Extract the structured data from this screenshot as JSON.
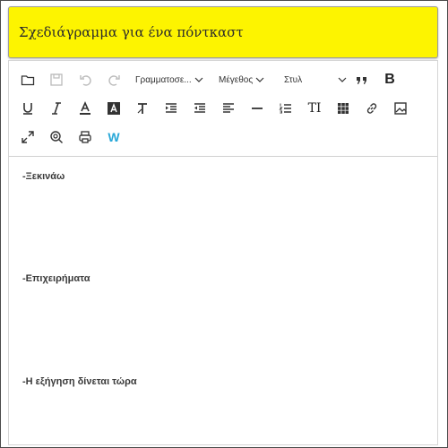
{
  "document": {
    "title": "Σχεδιάγραμμα για ένα πόντκαστ"
  },
  "toolbar": {
    "font_dropdown": "Γραμματοσε...",
    "size_dropdown": "Μέγεθος",
    "style_dropdown": "Στυλ",
    "bold_label": "B",
    "text_size_label": "TI",
    "word_label": "W"
  },
  "content": {
    "paragraphs": [
      "-Ξεκινάω",
      "-Επιχειρήματα",
      "-Η εξήγηση δίνεται τώρα"
    ]
  }
}
